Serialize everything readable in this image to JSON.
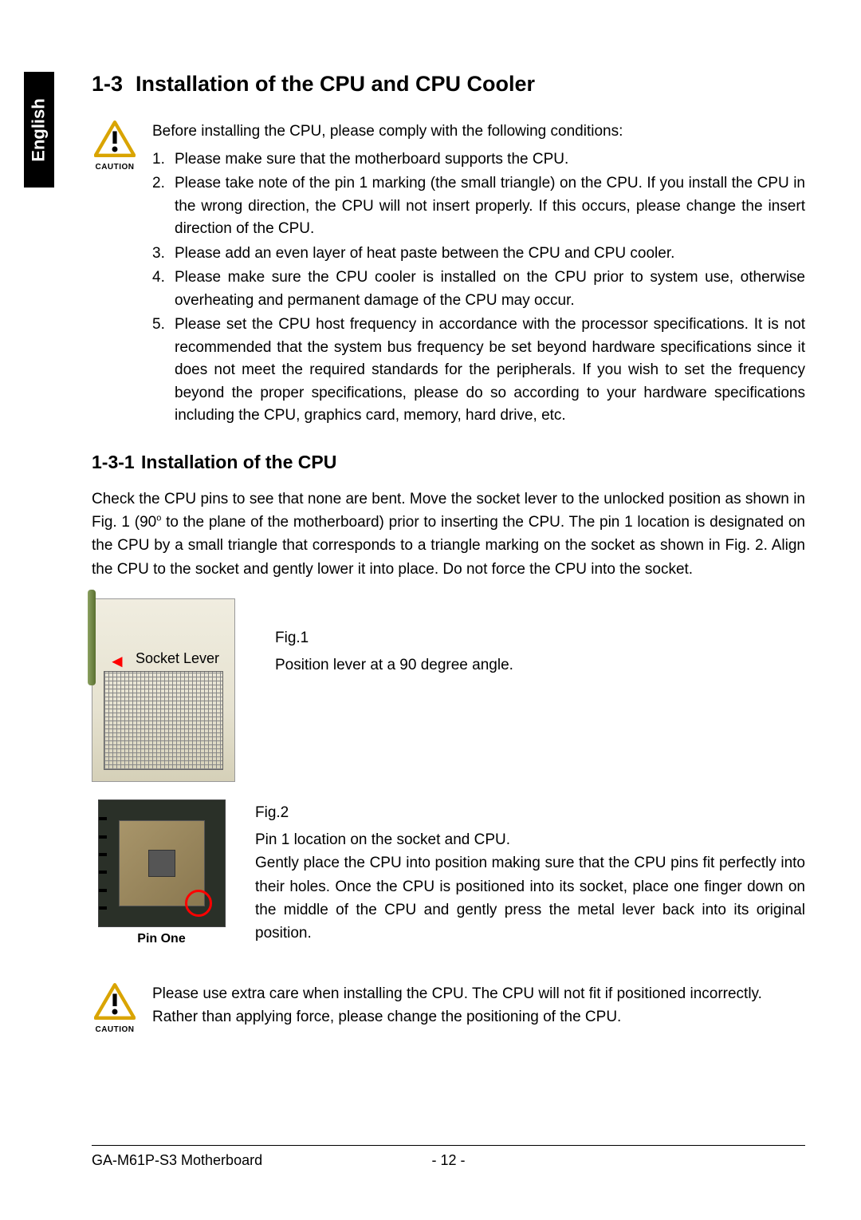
{
  "sideTab": "English",
  "section": {
    "num": "1-3",
    "title": "Installation of the CPU and CPU Cooler"
  },
  "caution1": {
    "label": "CAUTION",
    "intro": "Before installing the CPU, please comply with the following conditions:",
    "items": [
      "Please make sure that the motherboard supports the CPU.",
      "Please take note of the pin 1 marking (the small triangle) on the CPU.  If you install the CPU in the wrong direction, the CPU will not insert properly.  If this occurs, please change the insert direction of the CPU.",
      "Please add an even layer of heat paste between the CPU and CPU cooler.",
      "Please make sure the CPU cooler is installed on the CPU prior to system use, otherwise overheating and permanent damage of the CPU may occur.",
      "Please set the CPU host frequency in accordance with the processor specifications.  It is not recommended that the system bus frequency be set beyond hardware specifications since it does not meet the required standards for the peripherals.  If you wish to set the frequency beyond the proper specifications, please do so according to your hardware specifications including the CPU, graphics card, memory, hard drive, etc."
    ]
  },
  "subsection": {
    "num": "1-3-1",
    "title": "Installation of the CPU"
  },
  "body1a": "Check the CPU pins to see that none are bent. Move the socket lever to the unlocked position as shown in Fig. 1 (90",
  "body1b": " to the plane of the motherboard) prior to inserting the CPU. The pin 1 location is designated on the CPU by a small triangle that corresponds to a triangle marking on the socket as shown in Fig. 2. Align the CPU to the socket and gently lower it into place. Do not force the CPU into the socket.",
  "degreeSymbol": "o",
  "fig1": {
    "socketLeverLabel": "Socket Lever",
    "num": "Fig.1",
    "caption": "Position lever at a 90 degree angle."
  },
  "fig2": {
    "num": "Fig.2",
    "caption": "Pin 1 location on the socket and CPU.",
    "body": "Gently place the CPU into position making sure that the CPU pins fit perfectly into their holes. Once the CPU is positioned into its socket, place one finger down on the middle of the CPU and gently press the metal lever back into its original position.",
    "pinOneLabel": "Pin One"
  },
  "caution2": {
    "label": "CAUTION",
    "text": "Please use extra care when installing the CPU. The CPU will not fit if positioned incorrectly. Rather than applying force, please change the positioning of the CPU."
  },
  "footer": {
    "title": "GA-M61P-S3 Motherboard",
    "page": "- 12 -"
  }
}
